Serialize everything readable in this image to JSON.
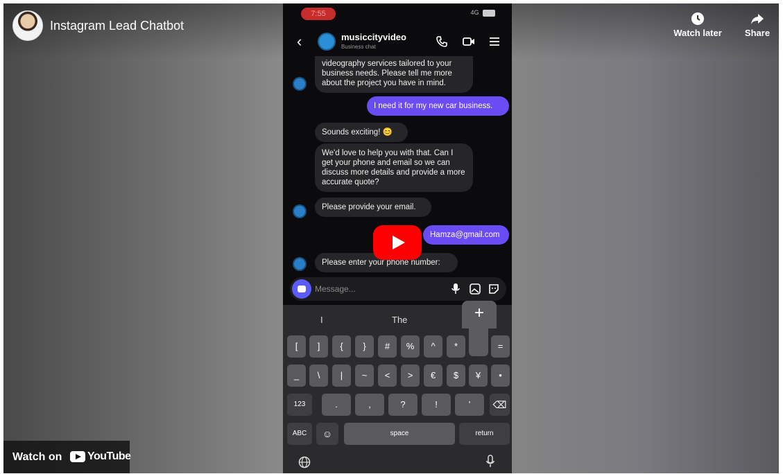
{
  "player": {
    "title": "Instagram Lead Chatbot",
    "watch_later": "Watch later",
    "share": "Share",
    "watch_on": "Watch on",
    "youtube": "YouTube"
  },
  "phone": {
    "status_time": "7:55",
    "status_signal": "4G",
    "chat_name": "musiccityvideo",
    "chat_sub": "Business chat",
    "messages": {
      "m1": "videography services tailored to your business needs. Please tell me more about the project you have in mind.",
      "m2": "I need it for my new car business.",
      "m3": "Sounds exciting! 😊",
      "m4": "We'd love to help you with that. Can I get your phone and email so we can discuss more details and provide a more accurate quote?",
      "m5": "Please provide your email.",
      "m6": "Hamza@gmail.com",
      "m7": "Please enter your phone number:"
    },
    "composer_placeholder": "Message...",
    "keyboard": {
      "suggestions": [
        "I",
        "The"
      ],
      "popup": "+",
      "row1": [
        "[",
        "]",
        "{",
        "}",
        "#",
        "%",
        "^",
        "*",
        "=",
        ""
      ],
      "row2": [
        "_",
        "\\",
        "|",
        "~",
        "<",
        ">",
        "€",
        "$",
        "¥",
        "•"
      ],
      "row3": [
        "123",
        ".",
        ",",
        "?",
        "!",
        "'",
        "⌫"
      ],
      "row4": [
        "ABC",
        "☺",
        "space",
        "return"
      ]
    }
  },
  "colors": {
    "sent_bubble": "#6a4cf5",
    "play_red": "#ff0000"
  }
}
